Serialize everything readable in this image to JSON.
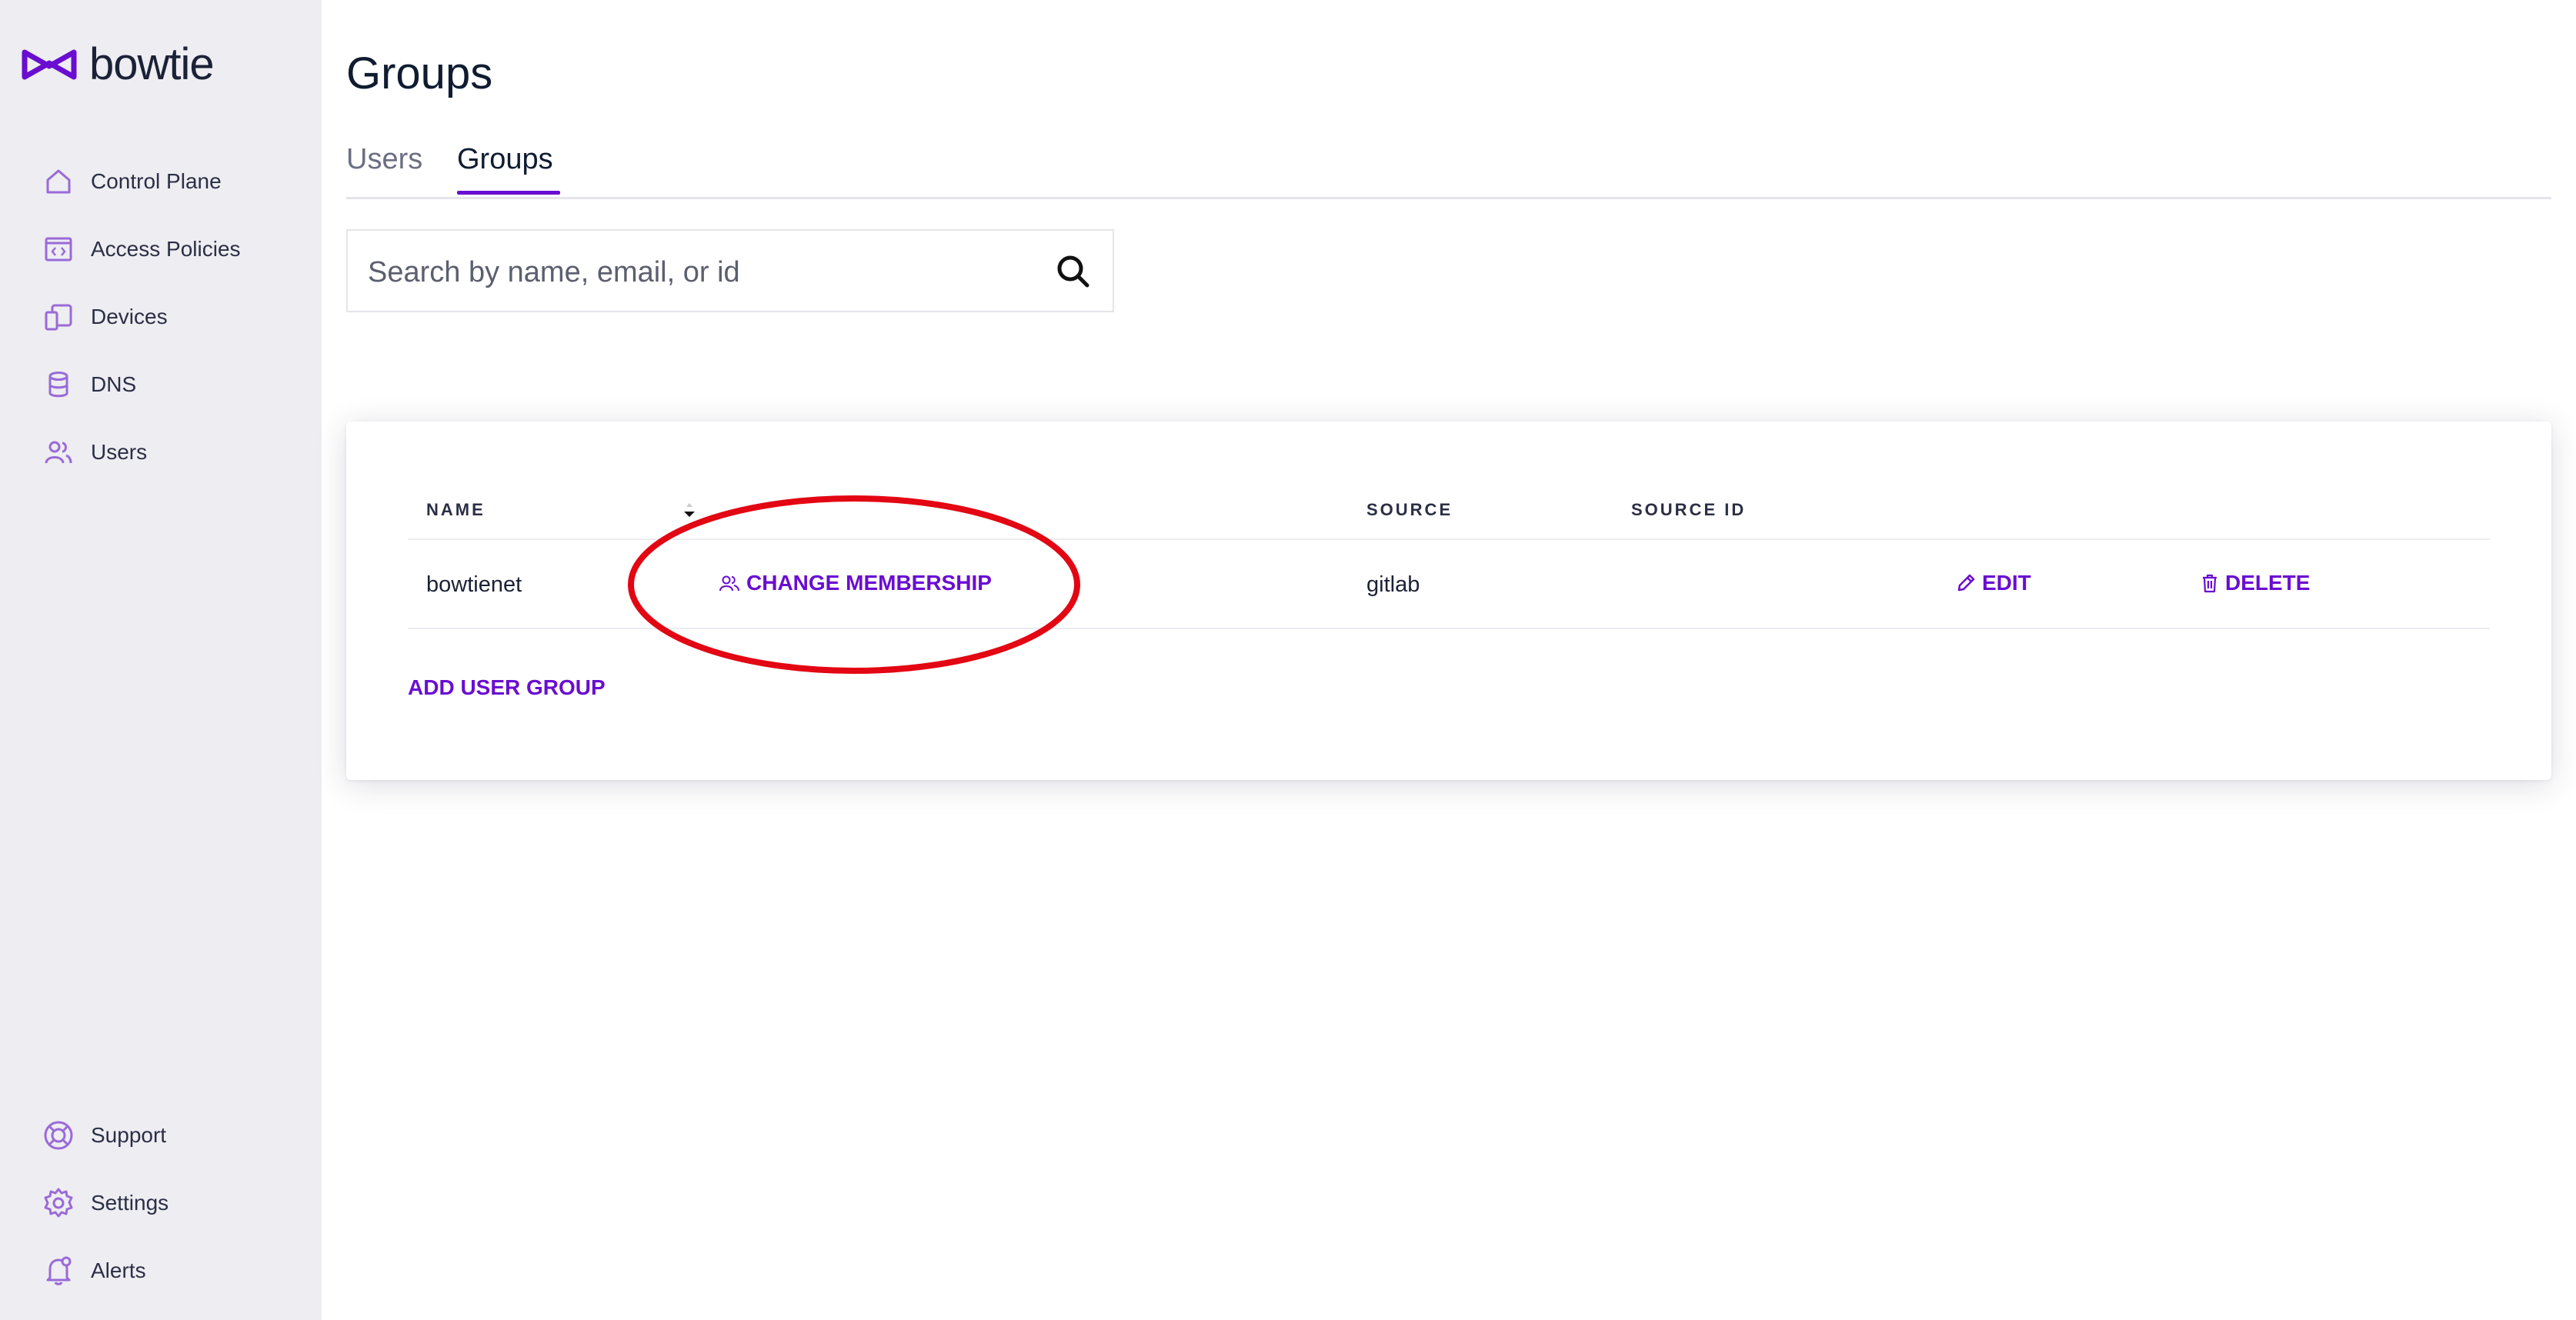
{
  "app": {
    "logo_text": "bowtie",
    "accent_color": "#6a0dd1"
  },
  "sidebar": {
    "items": [
      {
        "label": "Control Plane",
        "icon": "home-icon"
      },
      {
        "label": "Access Policies",
        "icon": "code-window-icon"
      },
      {
        "label": "Devices",
        "icon": "devices-icon"
      },
      {
        "label": "DNS",
        "icon": "database-icon"
      },
      {
        "label": "Users",
        "icon": "users-icon"
      }
    ],
    "bottom_items": [
      {
        "label": "Support",
        "icon": "lifebuoy-icon"
      },
      {
        "label": "Settings",
        "icon": "gear-icon"
      },
      {
        "label": "Alerts",
        "icon": "bell-icon"
      }
    ]
  },
  "page": {
    "title": "Groups"
  },
  "tabs": [
    {
      "label": "Users",
      "active": false
    },
    {
      "label": "Groups",
      "active": true
    }
  ],
  "search": {
    "placeholder": "Search by name, email, or id",
    "value": ""
  },
  "table": {
    "columns": [
      "NAME",
      "SOURCE",
      "SOURCE ID"
    ],
    "rows": [
      {
        "name": "bowtienet",
        "membership_action": "CHANGE MEMBERSHIP",
        "source": "gitlab",
        "source_id": "",
        "edit_label": "EDIT",
        "delete_label": "DELETE"
      }
    ],
    "add_label": "ADD USER GROUP"
  },
  "annotation": {
    "color": "#e30613",
    "shape": "ellipse around CHANGE MEMBERSHIP"
  }
}
